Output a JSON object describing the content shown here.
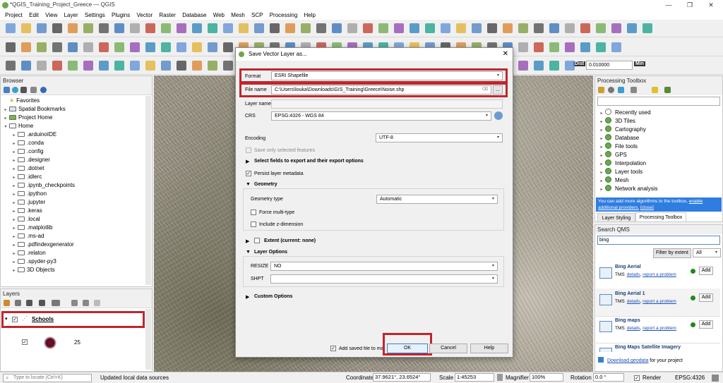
{
  "window": {
    "title": "*QGIS_Training_Project_Greece — QGIS"
  },
  "menu": [
    "Project",
    "Edit",
    "View",
    "Layer",
    "Settings",
    "Plugins",
    "Vector",
    "Raster",
    "Database",
    "Web",
    "Mesh",
    "SCP",
    "Processing",
    "Help"
  ],
  "toolbar": {
    "dist_label": "Dist",
    "dist_value": "0.010000",
    "min_label": "Min",
    "more": "»"
  },
  "browser": {
    "title": "Browser",
    "items": [
      "Favorites",
      "Spatial Bookmarks",
      "Project Home",
      "Home",
      ".arduinoIDE",
      ".conda",
      ".config",
      ".designer",
      ".dotnet",
      ".idlerc",
      ".ipynb_checkpoints",
      ".ipython",
      ".jupyter",
      ".keras",
      ".local",
      ".matplotlib",
      ".ms-ad",
      ".pdfindexgenerator",
      ".relaton",
      ".spyder-py3",
      "3D Objects"
    ]
  },
  "layers": {
    "title": "Layers",
    "layer_name": "Schools",
    "class_value": "25"
  },
  "dialog": {
    "title": "Save Vector Layer as...",
    "format_label": "Format",
    "format_value": "ESRI Shapefile",
    "filename_label": "File name",
    "filename_value": "C:\\Users\\louka\\Downloads\\GIS_Training\\Greece\\Noise.shp",
    "browse": "...",
    "layername_label": "Layer name",
    "crs_label": "CRS",
    "crs_value": "EPSG:4326 - WGS 84",
    "encoding_label": "Encoding",
    "encoding_value": "UTF-8",
    "save_selected": "Save only selected features",
    "select_fields": "Select fields to export and their export options",
    "persist_metadata": "Persist layer metadata",
    "geometry_header": "Geometry",
    "geometry_type_label": "Geometry type",
    "geometry_type_value": "Automatic",
    "force_multi": "Force multi-type",
    "include_z": "Include z-dimension",
    "extent": "Extent (current: none)",
    "layer_options": "Layer Options",
    "resize_label": "RESIZE",
    "resize_value": "NO",
    "shpt_label": "SHPT",
    "custom_options": "Custom Options",
    "add_saved": "Add saved file to map",
    "ok": "OK",
    "cancel": "Cancel",
    "help": "Help"
  },
  "toolbox": {
    "title": "Processing Toolbox",
    "items": [
      "Recently used",
      "3D Tiles",
      "Cartography",
      "Database",
      "File tools",
      "GPS",
      "Interpolation",
      "Layer tools",
      "Mesh",
      "Network analysis"
    ],
    "info_text": "You can add more algorithms to the toolbox,",
    "info_link1": "enable additional providers.",
    "info_link2": "[close]",
    "tab1": "Layer Styling",
    "tab2": "Processing Toolbox"
  },
  "qms": {
    "title": "Search QMS",
    "query": "bing",
    "filter_btn": "Filter by extent",
    "filter_sel": "All",
    "results": [
      {
        "name": "Bing Aerial",
        "type": "TMS",
        "details": "details",
        "report": "report a problem",
        "add": "Add"
      },
      {
        "name": "Bing Aerial 1",
        "type": "TMS",
        "details": "details",
        "report": "report a problem",
        "add": "Add"
      },
      {
        "name": "Bing maps",
        "type": "TMS",
        "details": "details",
        "report": "report a problem",
        "add": "Add"
      },
      {
        "name": "Bing Maps Satellite Imagery",
        "type": "",
        "details": "",
        "report": "",
        "add": ""
      }
    ],
    "download": "Download geodata",
    "download_suffix": "for your project"
  },
  "status": {
    "locate": "Type to locate (Ctrl+K)",
    "message": "Updated local data sources",
    "coord_label": "Coordinate",
    "coord_value": "37.9621°, 23.6524°",
    "scale_label": "Scale",
    "scale_value": "1:45253",
    "magnifier_label": "Magnifier",
    "magnifier_value": "100%",
    "rotation_label": "Rotation",
    "rotation_value": "0.0 °",
    "render_label": "Render",
    "crs": "EPSG:4326"
  }
}
